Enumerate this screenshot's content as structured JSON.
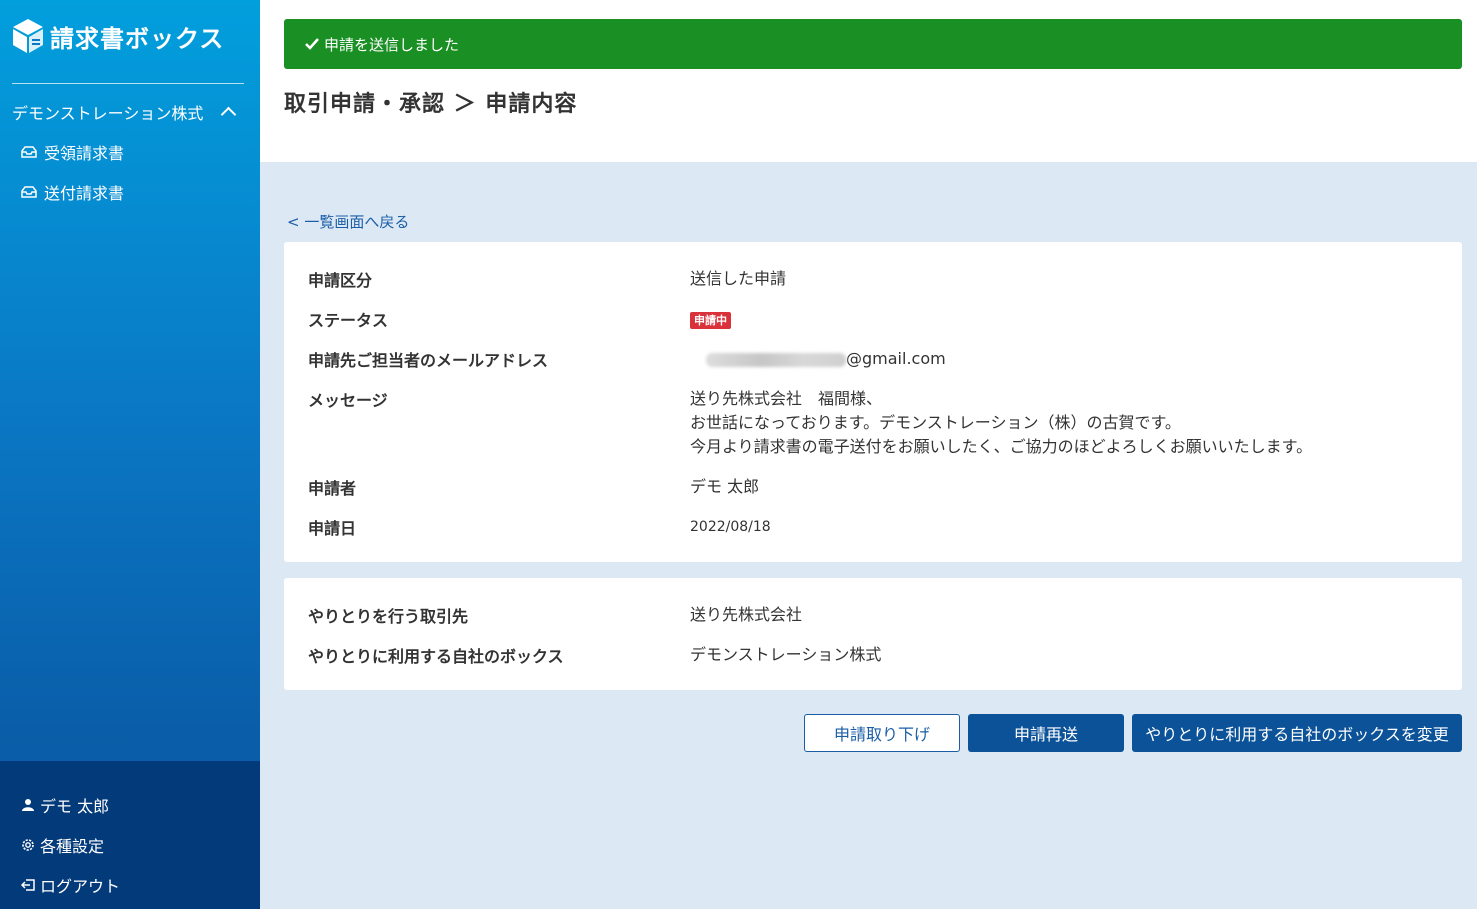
{
  "sidebar": {
    "logo_text": "請求書ボックス",
    "company": "デモンストレーション株式",
    "items": [
      {
        "label": "受領請求書",
        "icon": "inbox-icon"
      },
      {
        "label": "送付請求書",
        "icon": "inbox-icon"
      }
    ],
    "bottom": {
      "user": "デモ 太郎",
      "settings": "各種設定",
      "logout": "ログアウト"
    }
  },
  "alert": {
    "message": "申請を送信しました"
  },
  "page_title": "取引申請・承認 ＞ 申請内容",
  "back_link": "< 一覧画面へ戻る",
  "details": {
    "type_label": "申請区分",
    "type_value": "送信した申請",
    "status_label": "ステータス",
    "status_value": "申請中",
    "email_label": "申請先ご担当者のメールアドレス",
    "email_domain": "@gmail.com",
    "message_label": "メッセージ",
    "message_lines": [
      "送り先株式会社　福間様、",
      "お世話になっております。デモンストレーション（株）の古賀です。",
      "今月より請求書の電子送付をお願いしたく、ご協力のほどよろしくお願いいたします。"
    ],
    "applicant_label": "申請者",
    "applicant_value": "デモ 太郎",
    "date_label": "申請日",
    "date_value": "2022/08/18"
  },
  "partner": {
    "partner_label": "やりとりを行う取引先",
    "partner_value": "送り先株式会社",
    "box_label": "やりとりに利用する自社のボックス",
    "box_value": "デモンストレーション株式"
  },
  "buttons": {
    "withdraw": "申請取り下げ",
    "resend": "申請再送",
    "change_box": "やりとりに利用する自社のボックスを変更"
  },
  "colors": {
    "alert": "#1a8f23",
    "primary": "#0b5299",
    "badge": "#d9323b",
    "link": "#1b5ea6"
  }
}
